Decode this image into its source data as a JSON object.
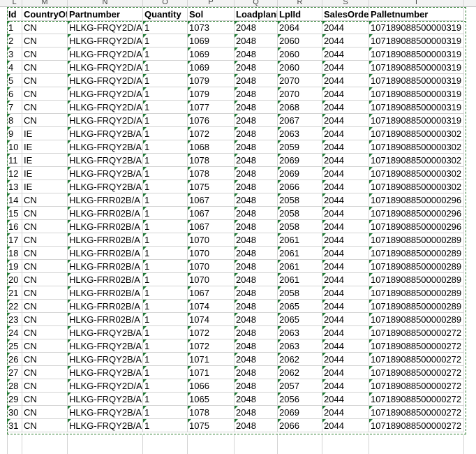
{
  "column_letters": [
    "L",
    "M",
    "N",
    "O",
    "P",
    "Q",
    "R",
    "S",
    "T"
  ],
  "headers": [
    "Id",
    "CountryOf",
    "Partnumber",
    "Quantity",
    "Sol",
    "Loadplani",
    "LpIId",
    "SalesOrde",
    "Palletnumber"
  ],
  "rows": [
    [
      "1",
      "CN",
      "HLKG-FRQY2D/A",
      "1",
      "1073",
      "2048",
      "2064",
      "2044",
      "107189088500000319"
    ],
    [
      "2",
      "CN",
      "HLKG-FRQY2D/A",
      "1",
      "1069",
      "2048",
      "2060",
      "2044",
      "107189088500000319"
    ],
    [
      "3",
      "CN",
      "HLKG-FRQY2D/A",
      "1",
      "1069",
      "2048",
      "2060",
      "2044",
      "107189088500000319"
    ],
    [
      "4",
      "CN",
      "HLKG-FRQY2D/A",
      "1",
      "1069",
      "2048",
      "2060",
      "2044",
      "107189088500000319"
    ],
    [
      "5",
      "CN",
      "HLKG-FRQY2D/A",
      "1",
      "1079",
      "2048",
      "2070",
      "2044",
      "107189088500000319"
    ],
    [
      "6",
      "CN",
      "HLKG-FRQY2D/A",
      "1",
      "1079",
      "2048",
      "2070",
      "2044",
      "107189088500000319"
    ],
    [
      "7",
      "CN",
      "HLKG-FRQY2D/A",
      "1",
      "1077",
      "2048",
      "2068",
      "2044",
      "107189088500000319"
    ],
    [
      "8",
      "CN",
      "HLKG-FRQY2D/A",
      "1",
      "1076",
      "2048",
      "2067",
      "2044",
      "107189088500000319"
    ],
    [
      "9",
      "IE",
      "HLKG-FRQY2B/A",
      "1",
      "1072",
      "2048",
      "2063",
      "2044",
      "107189088500000302"
    ],
    [
      "10",
      "IE",
      "HLKG-FRQY2B/A",
      "1",
      "1068",
      "2048",
      "2059",
      "2044",
      "107189088500000302"
    ],
    [
      "11",
      "IE",
      "HLKG-FRQY2B/A",
      "1",
      "1078",
      "2048",
      "2069",
      "2044",
      "107189088500000302"
    ],
    [
      "12",
      "IE",
      "HLKG-FRQY2B/A",
      "1",
      "1078",
      "2048",
      "2069",
      "2044",
      "107189088500000302"
    ],
    [
      "13",
      "IE",
      "HLKG-FRQY2B/A",
      "1",
      "1075",
      "2048",
      "2066",
      "2044",
      "107189088500000302"
    ],
    [
      "14",
      "CN",
      "HLKG-FRR02B/A",
      "1",
      "1067",
      "2048",
      "2058",
      "2044",
      "107189088500000296"
    ],
    [
      "15",
      "CN",
      "HLKG-FRR02B/A",
      "1",
      "1067",
      "2048",
      "2058",
      "2044",
      "107189088500000296"
    ],
    [
      "16",
      "CN",
      "HLKG-FRR02B/A",
      "1",
      "1067",
      "2048",
      "2058",
      "2044",
      "107189088500000296"
    ],
    [
      "17",
      "CN",
      "HLKG-FRR02B/A",
      "1",
      "1070",
      "2048",
      "2061",
      "2044",
      "107189088500000289"
    ],
    [
      "18",
      "CN",
      "HLKG-FRR02B/A",
      "1",
      "1070",
      "2048",
      "2061",
      "2044",
      "107189088500000289"
    ],
    [
      "19",
      "CN",
      "HLKG-FRR02B/A",
      "1",
      "1070",
      "2048",
      "2061",
      "2044",
      "107189088500000289"
    ],
    [
      "20",
      "CN",
      "HLKG-FRR02B/A",
      "1",
      "1070",
      "2048",
      "2061",
      "2044",
      "107189088500000289"
    ],
    [
      "21",
      "CN",
      "HLKG-FRR02B/A",
      "1",
      "1067",
      "2048",
      "2058",
      "2044",
      "107189088500000289"
    ],
    [
      "22",
      "CN",
      "HLKG-FRR02B/A",
      "1",
      "1074",
      "2048",
      "2065",
      "2044",
      "107189088500000289"
    ],
    [
      "23",
      "CN",
      "HLKG-FRR02B/A",
      "1",
      "1074",
      "2048",
      "2065",
      "2044",
      "107189088500000289"
    ],
    [
      "24",
      "CN",
      "HLKG-FRQY2B/A",
      "1",
      "1072",
      "2048",
      "2063",
      "2044",
      "107189088500000272"
    ],
    [
      "25",
      "CN",
      "HLKG-FRQY2B/A",
      "1",
      "1072",
      "2048",
      "2063",
      "2044",
      "107189088500000272"
    ],
    [
      "26",
      "CN",
      "HLKG-FRQY2B/A",
      "1",
      "1071",
      "2048",
      "2062",
      "2044",
      "107189088500000272"
    ],
    [
      "27",
      "CN",
      "HLKG-FRQY2B/A",
      "1",
      "1071",
      "2048",
      "2062",
      "2044",
      "107189088500000272"
    ],
    [
      "28",
      "CN",
      "HLKG-FRQY2D/A",
      "1",
      "1066",
      "2048",
      "2057",
      "2044",
      "107189088500000272"
    ],
    [
      "29",
      "CN",
      "HLKG-FRQY2B/A",
      "1",
      "1065",
      "2048",
      "2056",
      "2044",
      "107189088500000272"
    ],
    [
      "30",
      "CN",
      "HLKG-FRQY2B/A",
      "1",
      "1078",
      "2048",
      "2069",
      "2044",
      "107189088500000272"
    ],
    [
      "31",
      "CN",
      "HLKG-FRQY2B/A",
      "1",
      "1075",
      "2048",
      "2066",
      "2044",
      "107189088500000272"
    ]
  ],
  "colors": {
    "error_indicator": "#1e7a34",
    "selection_border": "#2e7d32",
    "gridline": "#d4d4d4"
  }
}
